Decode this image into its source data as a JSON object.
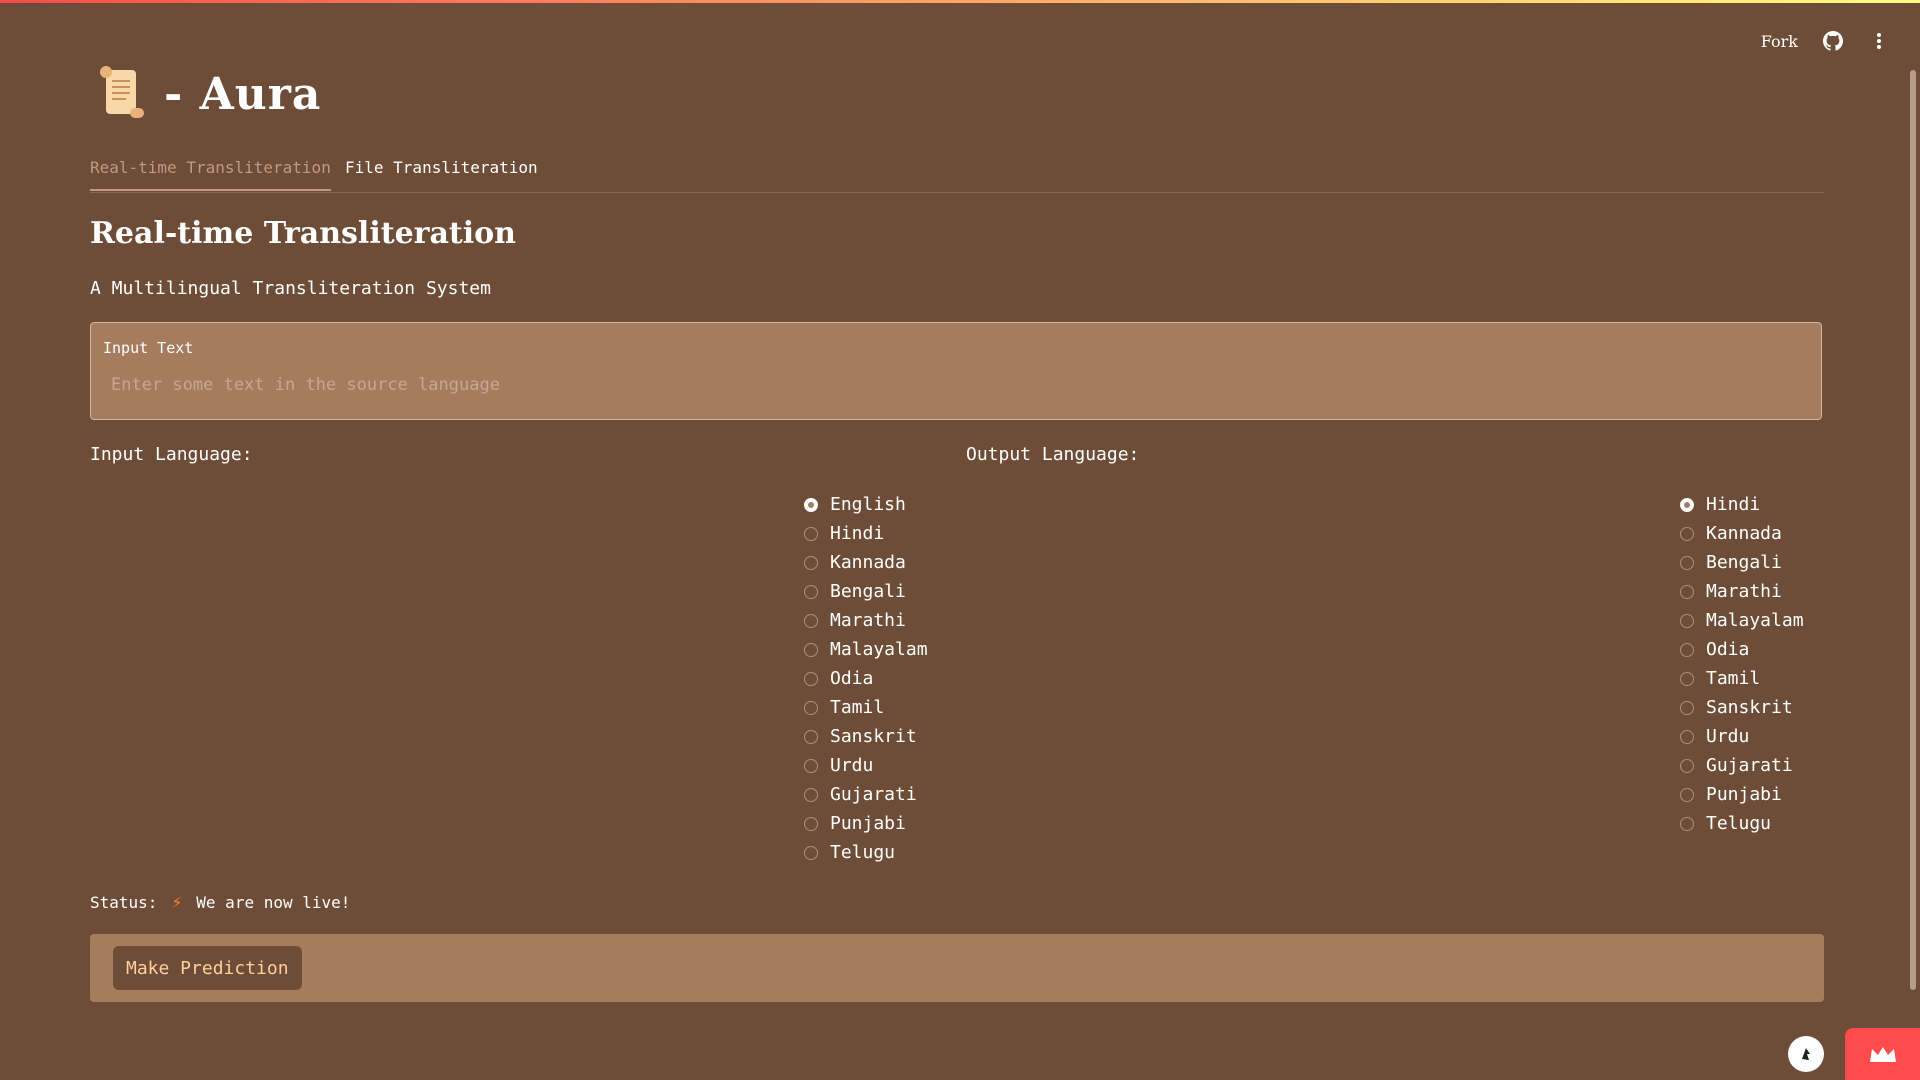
{
  "toolbar": {
    "fork_label": "Fork"
  },
  "header": {
    "title": "- Aura",
    "logo_icon": "scroll-icon"
  },
  "tabs": [
    {
      "label": "Real-time Transliteration",
      "active": true
    },
    {
      "label": "File Transliteration",
      "active": false
    }
  ],
  "main": {
    "title": "Real-time Transliteration",
    "subtitle": "A Multilingual Transliteration System",
    "input": {
      "label": "Input Text",
      "placeholder": "Enter some text in the source language",
      "value": ""
    }
  },
  "input_language": {
    "label": "Input Language:",
    "selected": "English",
    "options": [
      "English",
      "Hindi",
      "Kannada",
      "Bengali",
      "Marathi",
      "Malayalam",
      "Odia",
      "Tamil",
      "Sanskrit",
      "Urdu",
      "Gujarati",
      "Punjabi",
      "Telugu"
    ]
  },
  "output_language": {
    "label": "Output Language:",
    "selected": "Hindi",
    "options": [
      "Hindi",
      "Kannada",
      "Bengali",
      "Marathi",
      "Malayalam",
      "Odia",
      "Tamil",
      "Sanskrit",
      "Urdu",
      "Gujarati",
      "Punjabi",
      "Telugu"
    ]
  },
  "status": {
    "label": "Status:",
    "icon": "lightning-icon",
    "text": "We are now live!"
  },
  "actions": {
    "predict_label": "Make Prediction"
  },
  "colors": {
    "background": "#6d4d37",
    "panel": "#a67c5f",
    "accent": "#ffcf9e",
    "badge": "#ff4b4b"
  }
}
